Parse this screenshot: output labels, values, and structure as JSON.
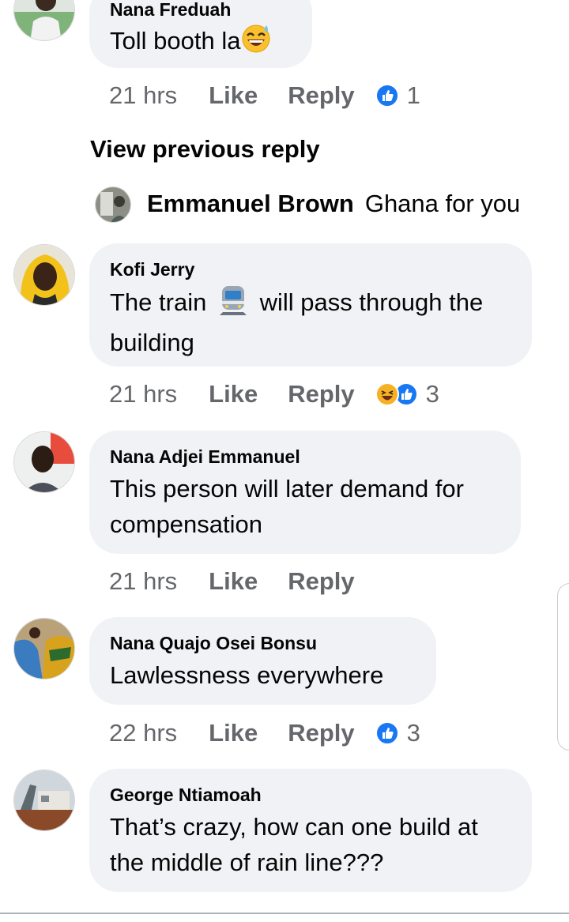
{
  "comments": [
    {
      "name": "Nana Freduah",
      "text": "Toll booth la",
      "emoji": "grinning-sweat-emoji",
      "time": "21 hrs",
      "like": "Like",
      "reply": "Reply",
      "reaction_count": "1"
    },
    {
      "name": "Kofi Jerry",
      "text_before": "The train",
      "emoji": "train-emoji",
      "text_after": "will pass through the",
      "text_line2": "building",
      "time": "21 hrs",
      "like": "Like",
      "reply": "Reply",
      "reaction_count": "3"
    },
    {
      "name": "Nana Adjei Emmanuel",
      "text_line1": "This person will later demand for",
      "text_line2": "compensation",
      "time": "21 hrs",
      "like": "Like",
      "reply": "Reply"
    },
    {
      "name": "Nana Quajo Osei Bonsu",
      "text": "Lawlessness everywhere",
      "time": "22 hrs",
      "like": "Like",
      "reply": "Reply",
      "reaction_count": "3"
    },
    {
      "name": "George Ntiamoah",
      "text_line1": "That’s crazy, how can one build at",
      "text_line2": "the middle of rain line???"
    }
  ],
  "view_previous_reply": "View previous reply",
  "inline_reply": {
    "name": "Emmanuel Brown",
    "text": "Ghana for you"
  },
  "colors": {
    "bubble": "#f0f2f5",
    "meta": "#65676b",
    "like_blue": "#1877f2",
    "haha_yellow": "#f7b125"
  }
}
